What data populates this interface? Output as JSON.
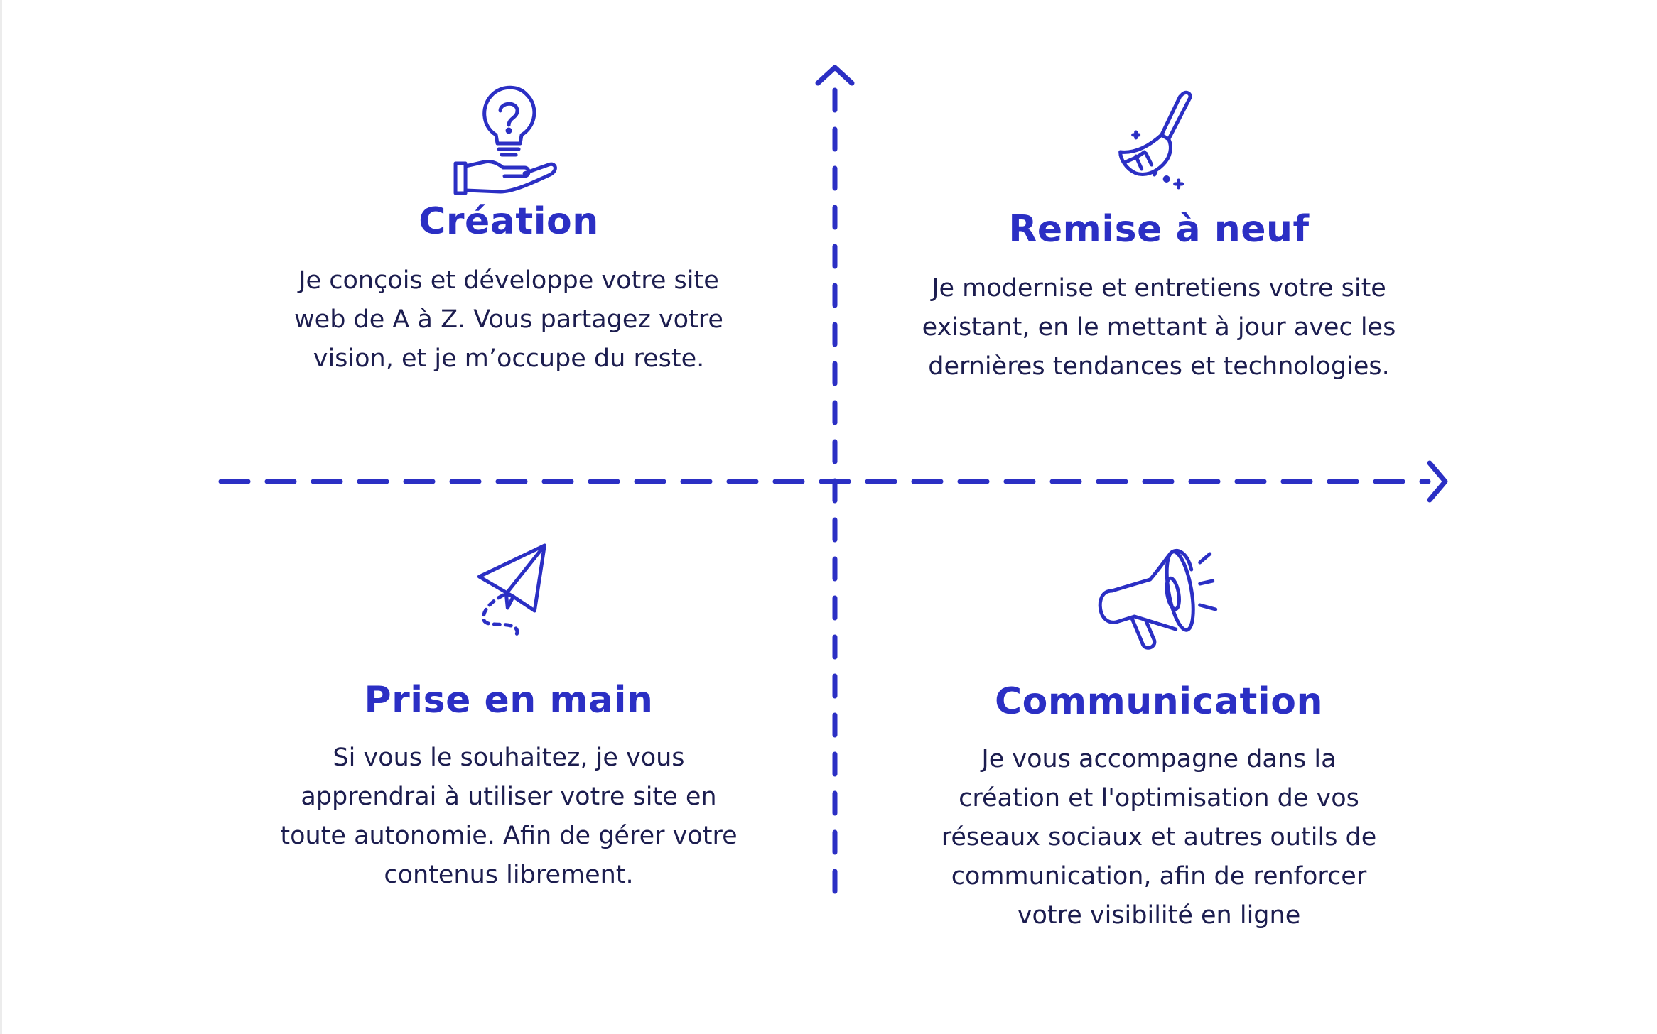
{
  "colors": {
    "accent": "#2b2fc4",
    "text": "#1c1d4f",
    "background": "#ffffff"
  },
  "quadrants": [
    {
      "id": "creation",
      "icon": "lightbulb-question-hand-icon",
      "title": "Création",
      "lines": [
        "Je conçois et développe votre site",
        "web de A à Z. Vous partagez votre",
        "vision, et je m’occupe du reste."
      ]
    },
    {
      "id": "remise",
      "icon": "broom-icon",
      "title": "Remise à neuf",
      "lines": [
        "Je modernise et entretiens votre site",
        "existant, en le mettant à jour avec les",
        "dernières tendances et technologies."
      ]
    },
    {
      "id": "prise",
      "icon": "paper-plane-icon",
      "title": "Prise en main",
      "lines": [
        "Si vous le souhaitez, je vous",
        "apprendrai à utiliser votre site en",
        "toute autonomie. Afin de gérer votre",
        "contenus librement."
      ]
    },
    {
      "id": "communication",
      "icon": "megaphone-icon",
      "title": "Communication",
      "lines": [
        "Je vous accompagne dans la",
        "création et l'optimisation de vos",
        "réseaux sociaux et autres outils de",
        "communication, afin de renforcer",
        "votre visibilité en ligne"
      ]
    }
  ]
}
